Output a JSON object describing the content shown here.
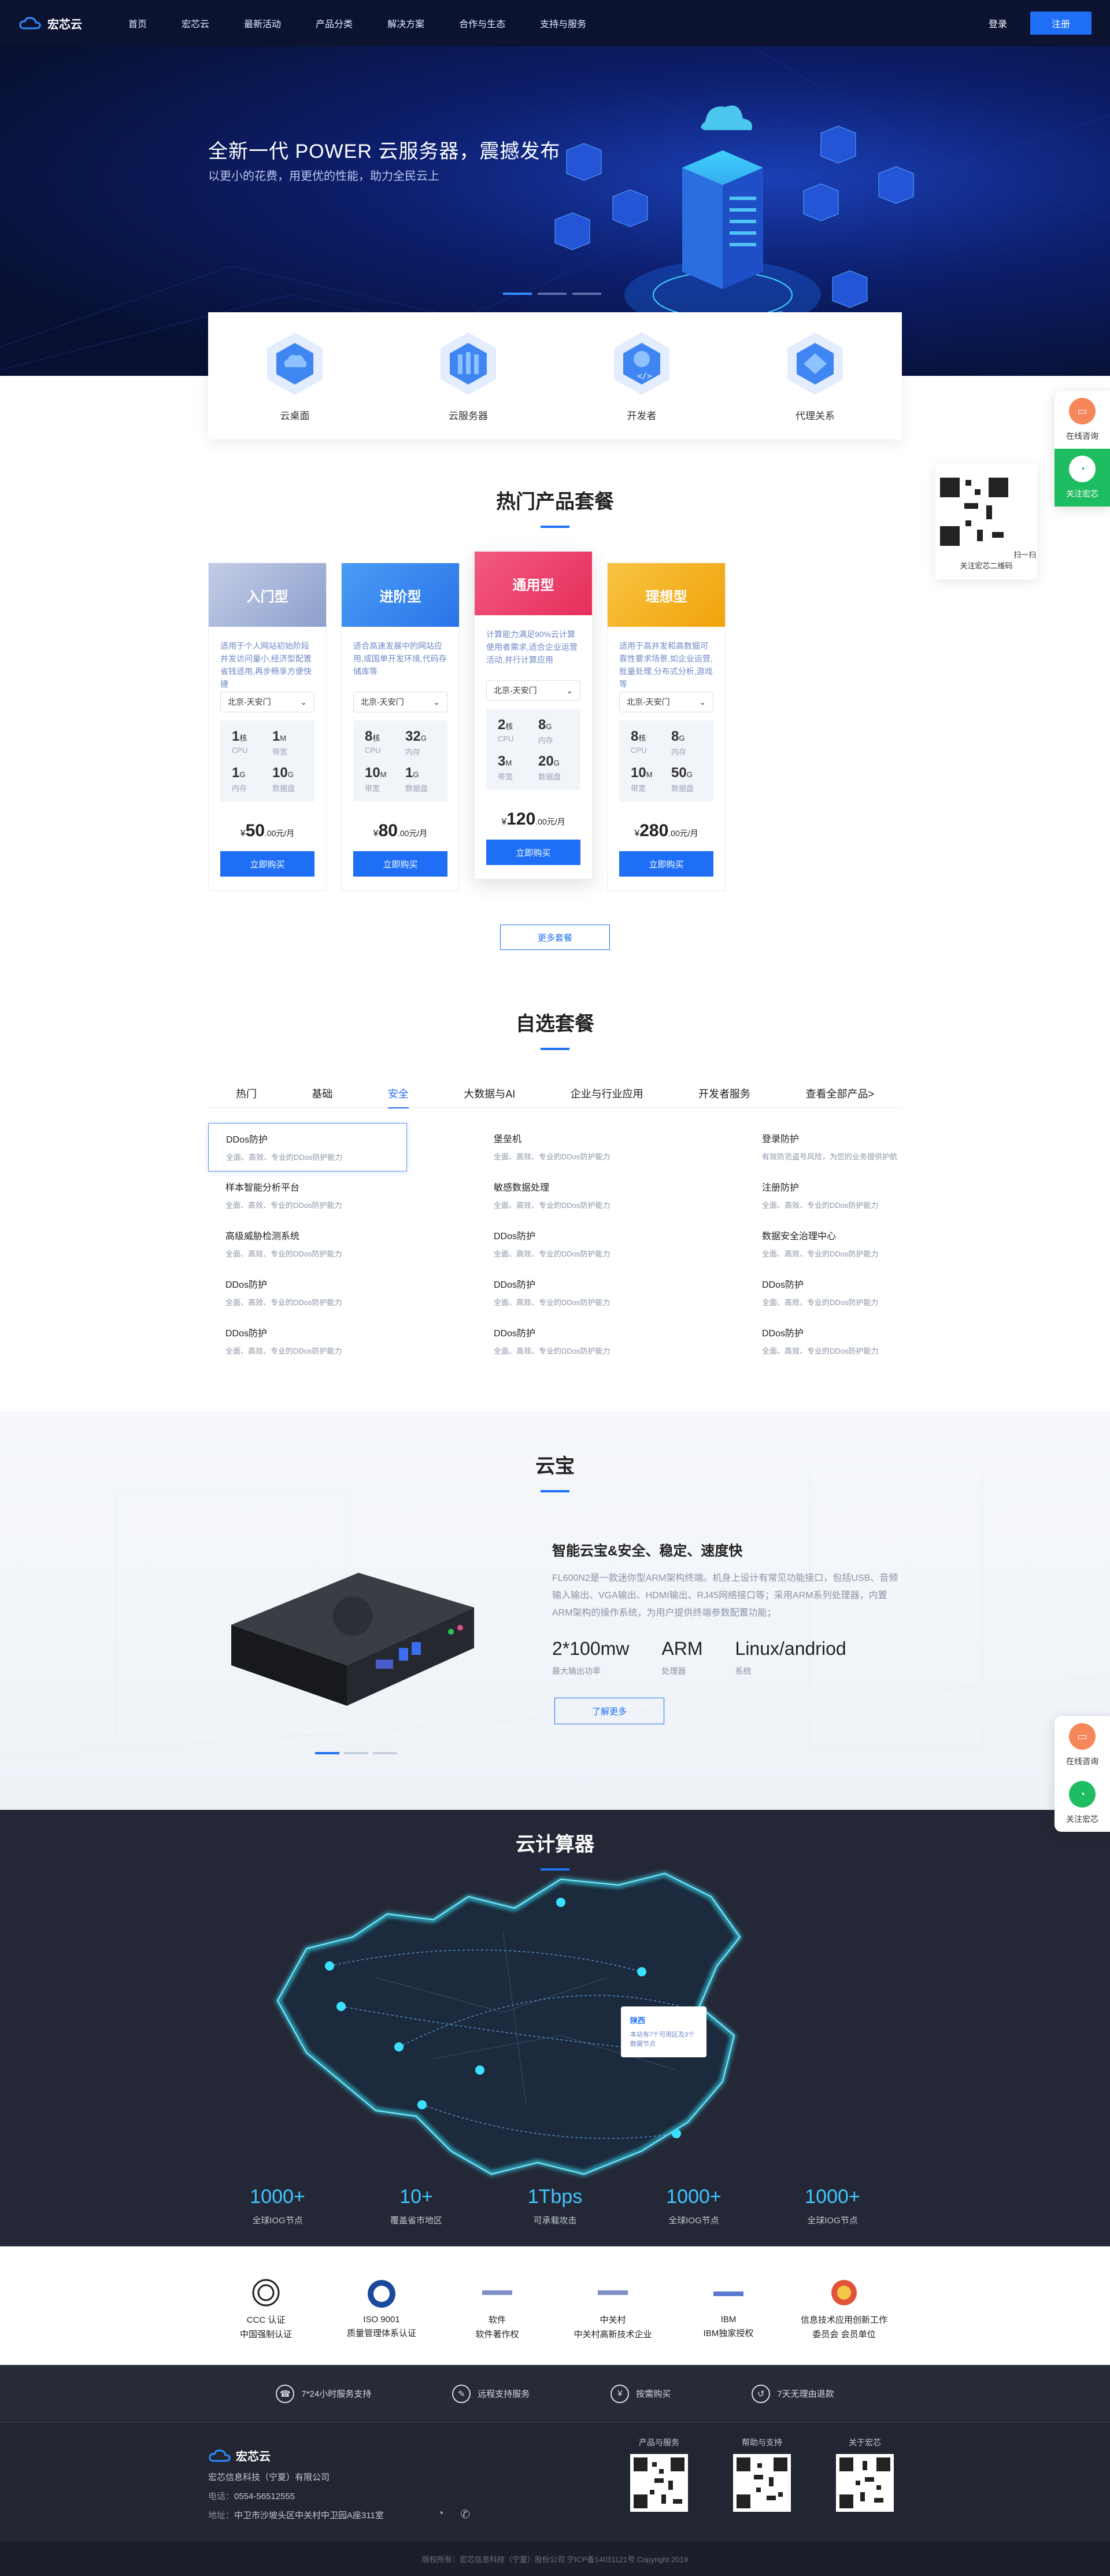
{
  "nav": {
    "brand": "宏芯云",
    "menu": [
      "首页",
      "宏芯云",
      "最新活动",
      "产品分类",
      "解决方案",
      "合作与生态",
      "支持与服务"
    ],
    "login": "登录",
    "register": "注册"
  },
  "hero": {
    "title": "全新一代 POWER 云服务器，震撼发布",
    "subtitle": "以更小的花费，用更优的性能，助力全民云上"
  },
  "categories": [
    "云桌面",
    "云服务器",
    "开发者",
    "代理关系"
  ],
  "products": {
    "title": "热门产品套餐",
    "cards": [
      {
        "name": "入门型",
        "desc": "适用于个人网站初始阶段并发访问量小,经济型配置省钱适用,再步畅享方便快捷",
        "region": "北京-天安门",
        "specs": [
          {
            "v": "1",
            "u": "核",
            "l": "CPU"
          },
          {
            "v": "1",
            "u": "M",
            "l": "带宽"
          },
          {
            "v": "1",
            "u": "G",
            "l": "内存"
          },
          {
            "v": "10",
            "u": "G",
            "l": "数据盘"
          }
        ],
        "price": "50",
        "price_unit": ".00元/月",
        "buy": "立即购买",
        "color": "#a9b6d8"
      },
      {
        "name": "进阶型",
        "desc": "适合高速发展中的网站应用,或国单开发环境,代码存储库等",
        "region": "北京-天安门",
        "specs": [
          {
            "v": "8",
            "u": "核",
            "l": "CPU"
          },
          {
            "v": "32",
            "u": "G",
            "l": "内存"
          },
          {
            "v": "10",
            "u": "M",
            "l": "带宽"
          },
          {
            "v": "1",
            "u": "G",
            "l": "数据盘"
          }
        ],
        "price": "80",
        "price_unit": ".00元/月",
        "buy": "立即购买",
        "color": "#3b8df0"
      },
      {
        "name": "通用型",
        "desc": "计算能力满足90%云计算使用者需求,适合企业运营活动,并行计算应用",
        "region": "北京-天安门",
        "specs": [
          {
            "v": "2",
            "u": "核",
            "l": "CPU"
          },
          {
            "v": "8",
            "u": "G",
            "l": "内存"
          },
          {
            "v": "3",
            "u": "M",
            "l": "带宽"
          },
          {
            "v": "20",
            "u": "G",
            "l": "数据盘"
          }
        ],
        "price": "120",
        "price_unit": ".00元/月",
        "buy": "立即购买",
        "color": "#ef3f6a"
      },
      {
        "name": "理想型",
        "desc": "适用于高并发和高数据可靠性要求场景,如企业运营,批量处理,分布式分析,游戏等",
        "region": "北京-天安门",
        "specs": [
          {
            "v": "8",
            "u": "核",
            "l": "CPU"
          },
          {
            "v": "8",
            "u": "G",
            "l": "内存"
          },
          {
            "v": "10",
            "u": "M",
            "l": "带宽"
          },
          {
            "v": "50",
            "u": "G",
            "l": "数据盘"
          }
        ],
        "price": "280",
        "price_unit": ".00元/月",
        "buy": "立即购买",
        "color": "#f6b51e"
      }
    ],
    "more": "更多套餐"
  },
  "custom": {
    "title": "自选套餐",
    "tabs": [
      "热门",
      "基础",
      "安全",
      "大数据与AI",
      "企业与行业应用",
      "开发者服务",
      "查看全部产品>"
    ],
    "items": [
      {
        "t": "DDos防护",
        "d": "全面、高效、专业的DDos防护能力"
      },
      {
        "t": "堡垒机",
        "d": "全面、高效、专业的DDos防护能力"
      },
      {
        "t": "登录防护",
        "d": "有效防范盗号风险，为您的业务提供护航"
      },
      {
        "t": "样本智能分析平台",
        "d": "全面、高效、专业的DDos防护能力"
      },
      {
        "t": "敏感数据处理",
        "d": "全面、高效、专业的DDos防护能力"
      },
      {
        "t": "注册防护",
        "d": "全面、高效、专业的DDos防护能力"
      },
      {
        "t": "高级威胁检测系统",
        "d": "全面、高效、专业的DDos防护能力"
      },
      {
        "t": "DDos防护",
        "d": "全面、高效、专业的DDos防护能力"
      },
      {
        "t": "数据安全治理中心",
        "d": "全面、高效、专业的DDos防护能力"
      },
      {
        "t": "DDos防护",
        "d": "全面、高效、专业的DDos防护能力"
      },
      {
        "t": "DDos防护",
        "d": "全面、高效、专业的DDos防护能力"
      },
      {
        "t": "DDos防护",
        "d": "全面、高效、专业的DDos防护能力"
      },
      {
        "t": "DDos防护",
        "d": "全面、高效、专业的DDos防护能力"
      },
      {
        "t": "DDos防护",
        "d": "全面、高效、专业的DDos防护能力"
      },
      {
        "t": "DDos防护",
        "d": "全面、高效、专业的DDos防护能力"
      }
    ]
  },
  "yunbao": {
    "title": "云宝",
    "heading": "智能云宝&安全、稳定、速度快",
    "text": "FL600N2是一款迷你型ARM架构终端。机身上设计有常见功能接口，包括USB、音频输入输出、VGA输出、HDMI输出、RJ45网络接口等；采用ARM系列处理器，内置ARM架构的操作系统，为用户提供终端参数配置功能；",
    "stats": [
      {
        "v": "2*100mw",
        "l": "最大输出功率"
      },
      {
        "v": "ARM",
        "l": "处理器"
      },
      {
        "v": "Linux/andriod",
        "l": "系统"
      }
    ],
    "more": "了解更多"
  },
  "compute": {
    "title": "云计算器",
    "tip_title": "陕西",
    "tip_text": "本站有7个可用区及3个数据节点",
    "stats": [
      {
        "v": "1000+",
        "l": "全球IOG节点"
      },
      {
        "v": "10+",
        "l": "覆盖省市地区"
      },
      {
        "v": "1Tbps",
        "l": "可承载攻击"
      },
      {
        "v": "1000+",
        "l": "全球IOG节点"
      },
      {
        "v": "1000+",
        "l": "全球IOG节点"
      }
    ]
  },
  "certs": [
    {
      "a": "CCC 认证",
      "b": "中国强制认证"
    },
    {
      "a": "ISO 9001",
      "b": "质量管理体系认证"
    },
    {
      "a": "软件",
      "b": "软件著作权"
    },
    {
      "a": "中关村",
      "b": "中关村高新技术企业"
    },
    {
      "a": "IBM",
      "b": "IBM独家授权"
    },
    {
      "a": "信息技术应用创新工作",
      "b": "委员会 会员单位"
    }
  ],
  "services": [
    "7*24小时服务支持",
    "远程支持服务",
    "按需购买",
    "7天无理由退款"
  ],
  "footer": {
    "brand": "宏芯云",
    "company": "宏芯信息科技（宁夏）有限公司",
    "phone_label": "电话：",
    "phone": "0554-56512555",
    "addr_label": "地址：",
    "addr": "中卫市沙坡头区中关村中卫园A座311室",
    "qrs": [
      "产品与服务",
      "帮助与支持",
      "关于宏芯"
    ],
    "copy": "版权所有：宏芯信息科技（宁夏）股份公司 宁ICP备14031121号 Copyright 2019"
  },
  "float": {
    "chat": "在线咨询",
    "follow": "关注宏芯",
    "qr_caption": "扫一扫关注宏芯二维码"
  }
}
